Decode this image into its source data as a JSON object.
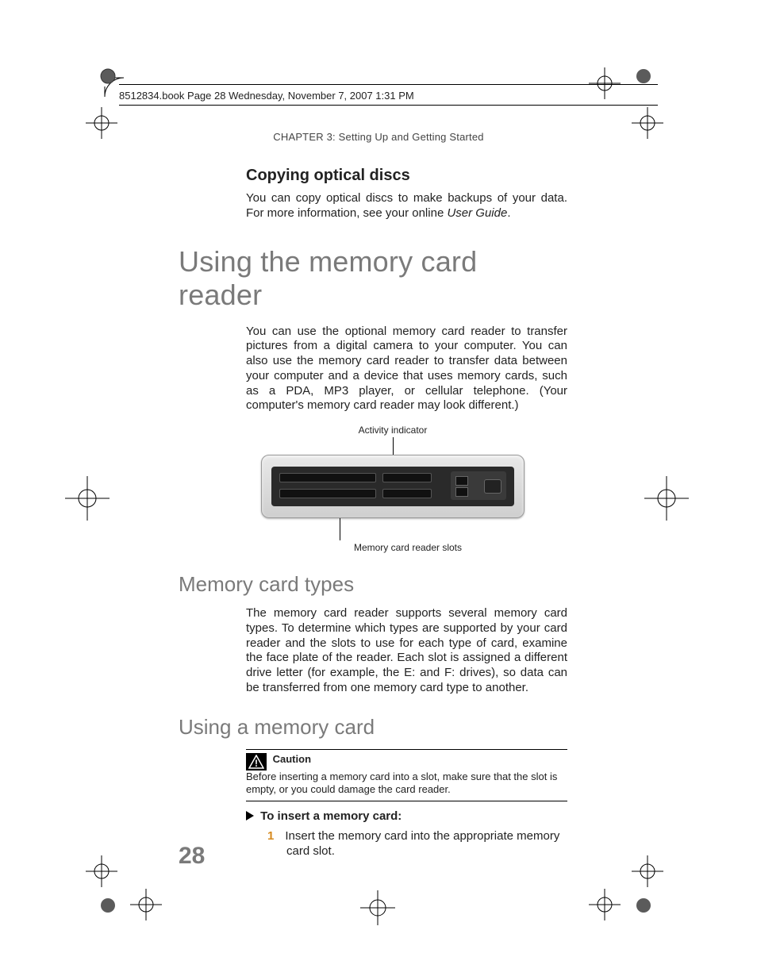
{
  "fm_header": "8512834.book  Page 28  Wednesday, November 7, 2007  1:31 PM",
  "chapter_header": "CHAPTER 3: Setting Up and Getting Started",
  "sections": {
    "copying_title": "Copying optical discs",
    "copying_para_a": "You can copy optical discs to make backups of your data. For more information, see your online ",
    "copying_para_italic": "User Guide",
    "copying_para_b": ".",
    "main_title": "Using the memory card reader",
    "main_para": "You can use the optional memory card reader to transfer pictures from a digital camera to your computer. You can also use the memory card reader to transfer data between your computer and a device that uses memory cards, such as a PDA, MP3 player, or cellular telephone. (Your computer's memory card reader may look different.)",
    "fig_label_top": "Activity indicator",
    "fig_label_bottom": "Memory card reader slots",
    "types_title": "Memory card types",
    "types_para": "The memory card reader supports several memory card types. To determine which types are supported by your card reader and the slots to use for each type of card, examine the face plate of the reader. Each slot is assigned a different drive letter (for example, the E: and F: drives), so data can be transferred from one memory card type to another.",
    "using_title": "Using a memory card",
    "caution_title": "Caution",
    "caution_text": "Before inserting a memory card into a slot, make sure that the slot is empty, or you could damage the card reader.",
    "proc_head": "To insert a memory card:",
    "step1_num": "1",
    "step1_text": "Insert the memory card into the appropriate memory card slot."
  },
  "page_number": "28"
}
